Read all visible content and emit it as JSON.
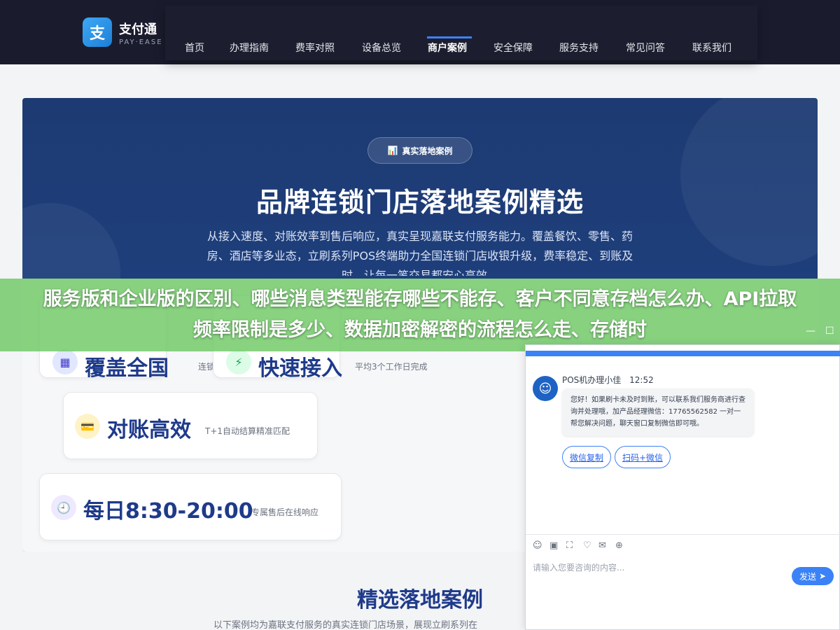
{
  "header": {
    "logo_char": "支",
    "brand_name": "支付通",
    "brand_sub": "PAY·EASE",
    "nav": [
      {
        "label": "首页"
      },
      {
        "label": "办理指南"
      },
      {
        "label": "费率对照"
      },
      {
        "label": "设备总览"
      },
      {
        "label": "商户案例",
        "active": true
      },
      {
        "label": "安全保障"
      },
      {
        "label": "服务支持"
      },
      {
        "label": "常见问答"
      },
      {
        "label": "联系我们"
      }
    ]
  },
  "hero": {
    "badge_icon": "📊",
    "badge_label": "真实落地案例",
    "title": "品牌连锁门店落地案例精选",
    "description": "从接入速度、对账效率到售后响应，真实呈现嘉联支付服务能力。覆盖餐饮、零售、药房、酒店等多业态，立刷系列POS终端助力全国连锁门店收银升级，费率稳定、到账及时，让每一笔交易都安心高效。",
    "stats": [
      {
        "icon": "▦",
        "main": "覆盖全国",
        "sub": "连锁门店"
      },
      {
        "icon": "⚡",
        "main": "快速接入",
        "sub": "平均3个工作日完成"
      },
      {
        "icon": "💳",
        "main": "对账高效",
        "sub": "T+1自动结算精准匹配"
      },
      {
        "icon": "🕘",
        "main": "每日8:30-20:00",
        "sub": "专属售后在线响应"
      }
    ]
  },
  "section": {
    "title": "精选落地案例",
    "description": "以下案例均为嘉联支付服务的真实连锁门店场景，展现立刷系列在"
  },
  "banner": {
    "text": "服务版和企业版的区别、哪些消息类型能存哪些不能存、客户不同意存档怎么办、API拉取频率限制是多少、数据加密解密的流程怎么走、存储时"
  },
  "chat": {
    "controls": [
      "—",
      "☐"
    ],
    "agent_avatar": "☺",
    "agent_name": "POS机办理小佳",
    "time": "12:52",
    "message": "您好！如果刷卡未及时到账，可以联系我们服务商进行查询并处理哦，加产品经理微信：17765562582 一对一帮您解决问题，聊天窗口复制微信即可哦。",
    "quick_buttons": [
      "微信复制",
      "扫码+微信"
    ],
    "toolbar_icons": [
      "☺",
      "▣",
      "⛶",
      "♡",
      "✉",
      "⊕"
    ],
    "input_placeholder": "请输入您要咨询的内容...",
    "send_label": "发送",
    "send_icon": "➤"
  }
}
